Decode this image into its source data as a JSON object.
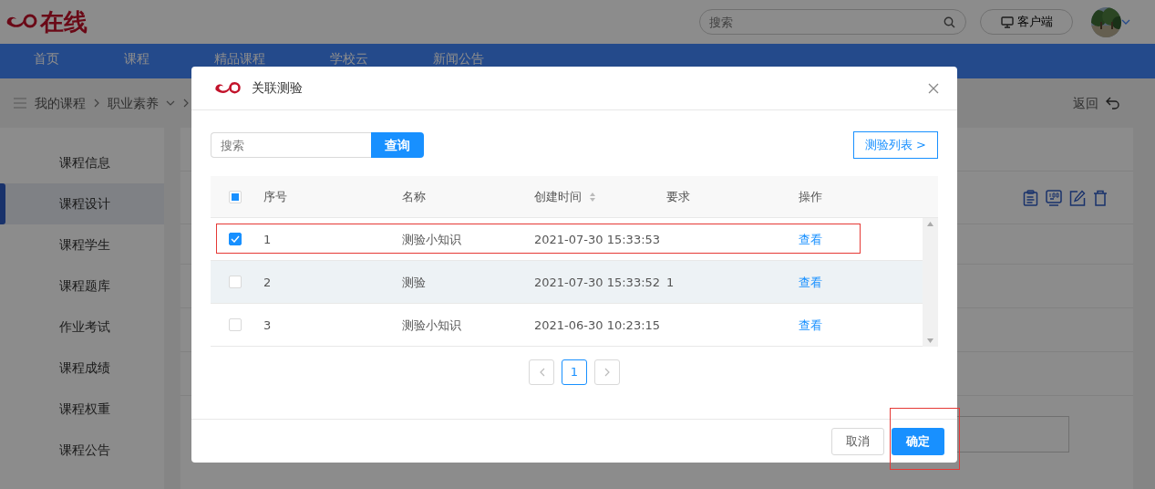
{
  "header": {
    "logo_text": "在线",
    "search": {
      "placeholder": "搜索"
    },
    "client_button": "客户端"
  },
  "nav": [
    {
      "label": "首页"
    },
    {
      "label": "课程"
    },
    {
      "label": "精品课程"
    },
    {
      "label": "学校云"
    },
    {
      "label": "新闻公告"
    }
  ],
  "breadcrumb": [
    {
      "label": "我的课程",
      "dropdown": false
    },
    {
      "label": "职业素养",
      "dropdown": true
    }
  ],
  "back_link": "返回",
  "sidebar": [
    {
      "label": "课程信息",
      "selected": false
    },
    {
      "label": "课程设计",
      "selected": true
    },
    {
      "label": "课程学生",
      "selected": false
    },
    {
      "label": "课程题库",
      "selected": false
    },
    {
      "label": "作业考试",
      "selected": false
    },
    {
      "label": "课程成绩",
      "selected": false
    },
    {
      "label": "课程权重",
      "selected": false
    },
    {
      "label": "课程公告",
      "selected": false
    }
  ],
  "dialog": {
    "title": "关联测验",
    "search": {
      "placeholder": "搜索"
    },
    "search_button": "查询",
    "list_button": "测验列表 >",
    "table": {
      "select_all": {
        "checked": false,
        "partial": true
      },
      "columns": [
        {
          "label": "序号",
          "sortable": false
        },
        {
          "label": "名称",
          "sortable": false
        },
        {
          "label": "创建时间",
          "sortable": true
        },
        {
          "label": "要求",
          "sortable": false
        },
        {
          "label": "操作",
          "sortable": false
        }
      ],
      "rows": [
        {
          "checked": true,
          "hovered": false,
          "highlighted": true,
          "cells": [
            "1",
            "测验小知识",
            "2021-07-30 15:33:53",
            ""
          ],
          "action": "查看"
        },
        {
          "checked": false,
          "hovered": true,
          "highlighted": false,
          "cells": [
            "2",
            "测验",
            "2021-07-30 15:33:52",
            "1"
          ],
          "action": "查看"
        },
        {
          "checked": false,
          "hovered": false,
          "highlighted": false,
          "cells": [
            "3",
            "测验小知识",
            "2021-06-30 10:23:15",
            ""
          ],
          "action": "查看"
        }
      ]
    },
    "pages": [
      {
        "label": "1",
        "selected": true
      }
    ],
    "cancel_button": "取消",
    "ok_button": {
      "label": "确定",
      "highlighted": true
    }
  }
}
